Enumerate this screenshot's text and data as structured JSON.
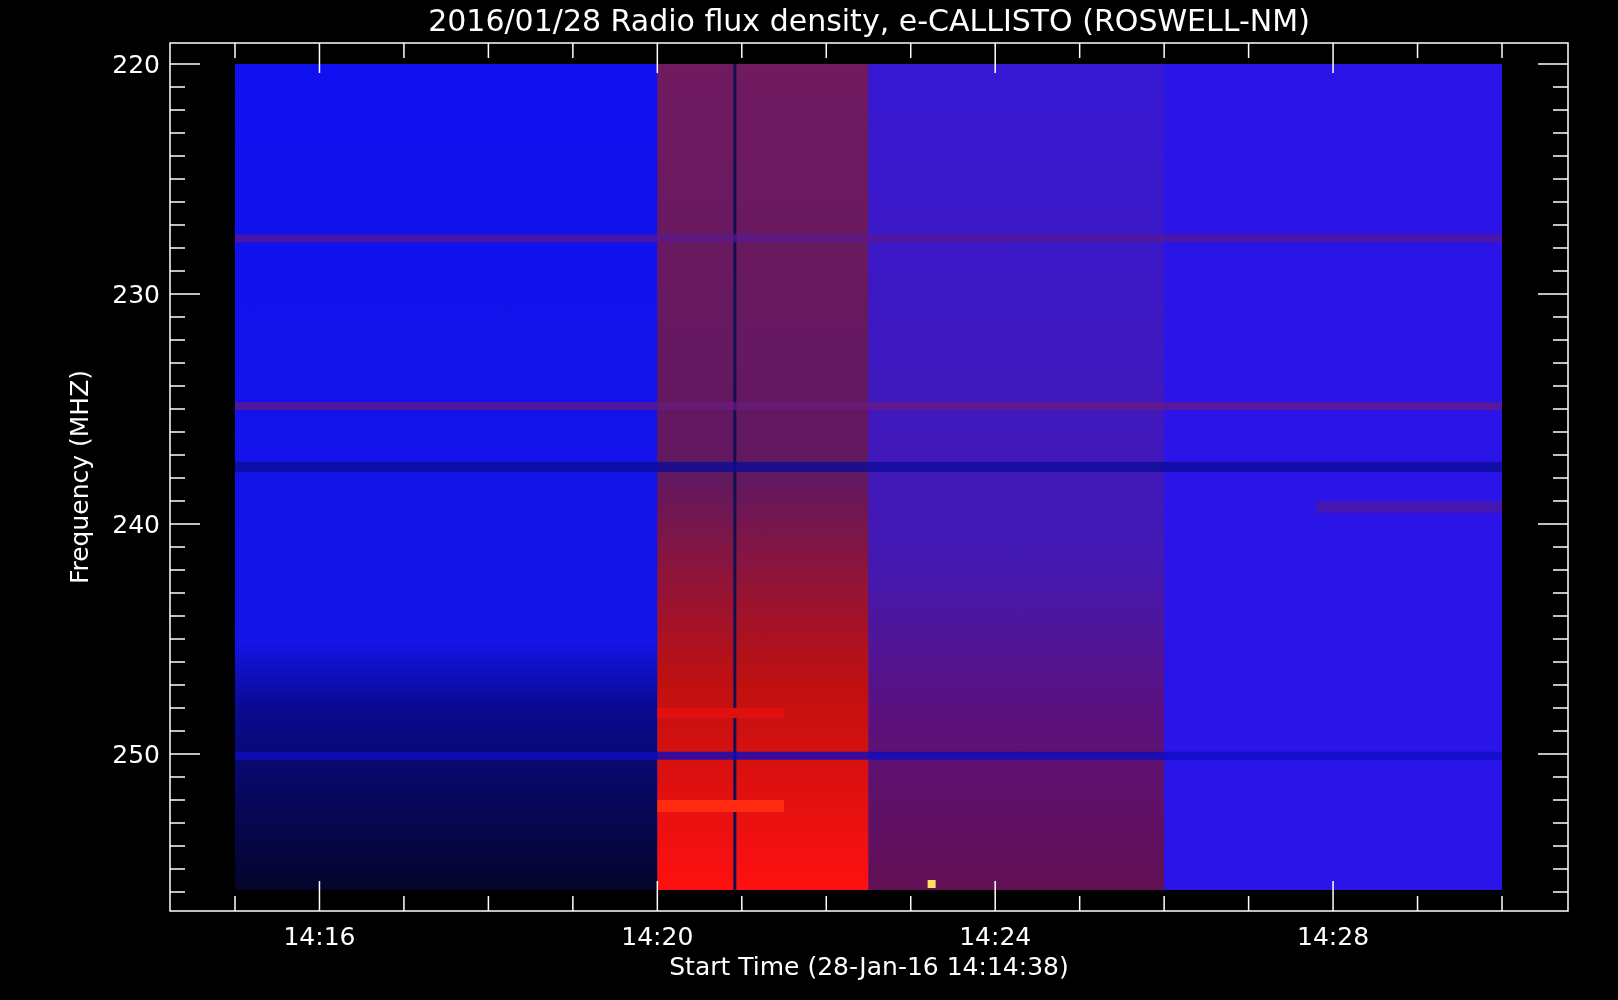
{
  "title": "2016/01/28  Radio flux density, e-CALLISTO (ROSWELL-NM)",
  "y_axis": {
    "label": "Frequency (MHZ)",
    "ticks": [
      "220",
      "230",
      "240",
      "250"
    ]
  },
  "x_axis": {
    "label": "Start Time (28-Jan-16 14:14:38)",
    "ticks": [
      "14:16",
      "14:20",
      "14:24",
      "14:28"
    ]
  }
}
